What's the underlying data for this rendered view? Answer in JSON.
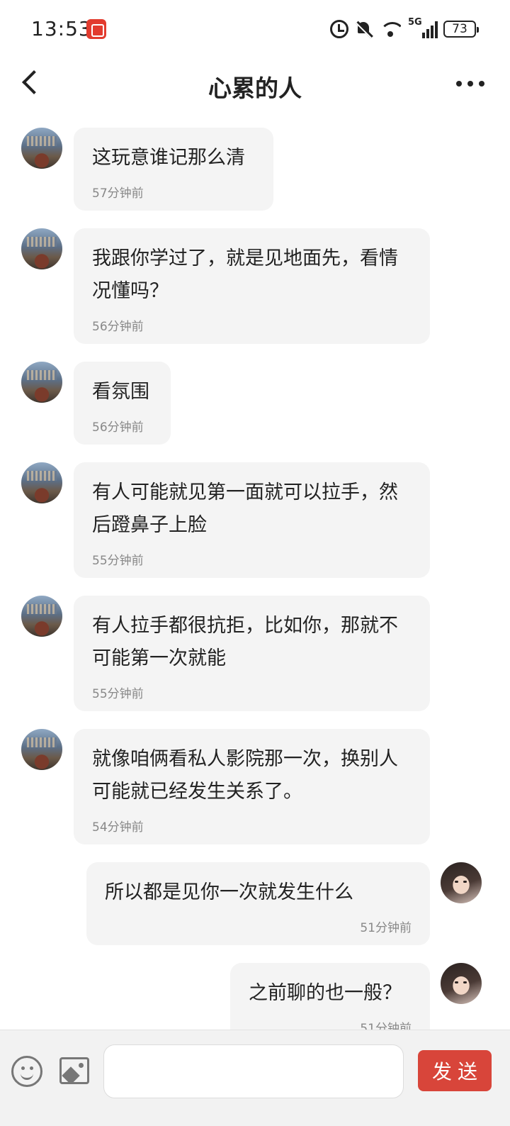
{
  "status_bar": {
    "time": "13:53",
    "network": "5G",
    "battery": "73"
  },
  "header": {
    "title": "心累的人"
  },
  "messages": [
    {
      "from": "other",
      "text": "这玩意谁记那么清",
      "time": "57分钟前"
    },
    {
      "from": "other",
      "text": "我跟你学过了，就是见地面先，看情况懂吗？",
      "time": "56分钟前"
    },
    {
      "from": "other",
      "text": "看氛围",
      "time": "56分钟前"
    },
    {
      "from": "other",
      "text": "有人可能就见第一面就可以拉手，然后蹬鼻子上脸",
      "time": "55分钟前"
    },
    {
      "from": "other",
      "text": "有人拉手都很抗拒，比如你，那就不可能第一次就能",
      "time": "55分钟前"
    },
    {
      "from": "other",
      "text": "就像咱俩看私人影院那一次，换别人可能就已经发生关系了。",
      "time": "54分钟前"
    },
    {
      "from": "self",
      "text": "所以都是见你一次就发生什么",
      "time": "51分钟前"
    },
    {
      "from": "self",
      "text": "之前聊的也一般？",
      "time": "51分钟前"
    }
  ],
  "input_bar": {
    "placeholder": "",
    "send_label": "发送"
  }
}
